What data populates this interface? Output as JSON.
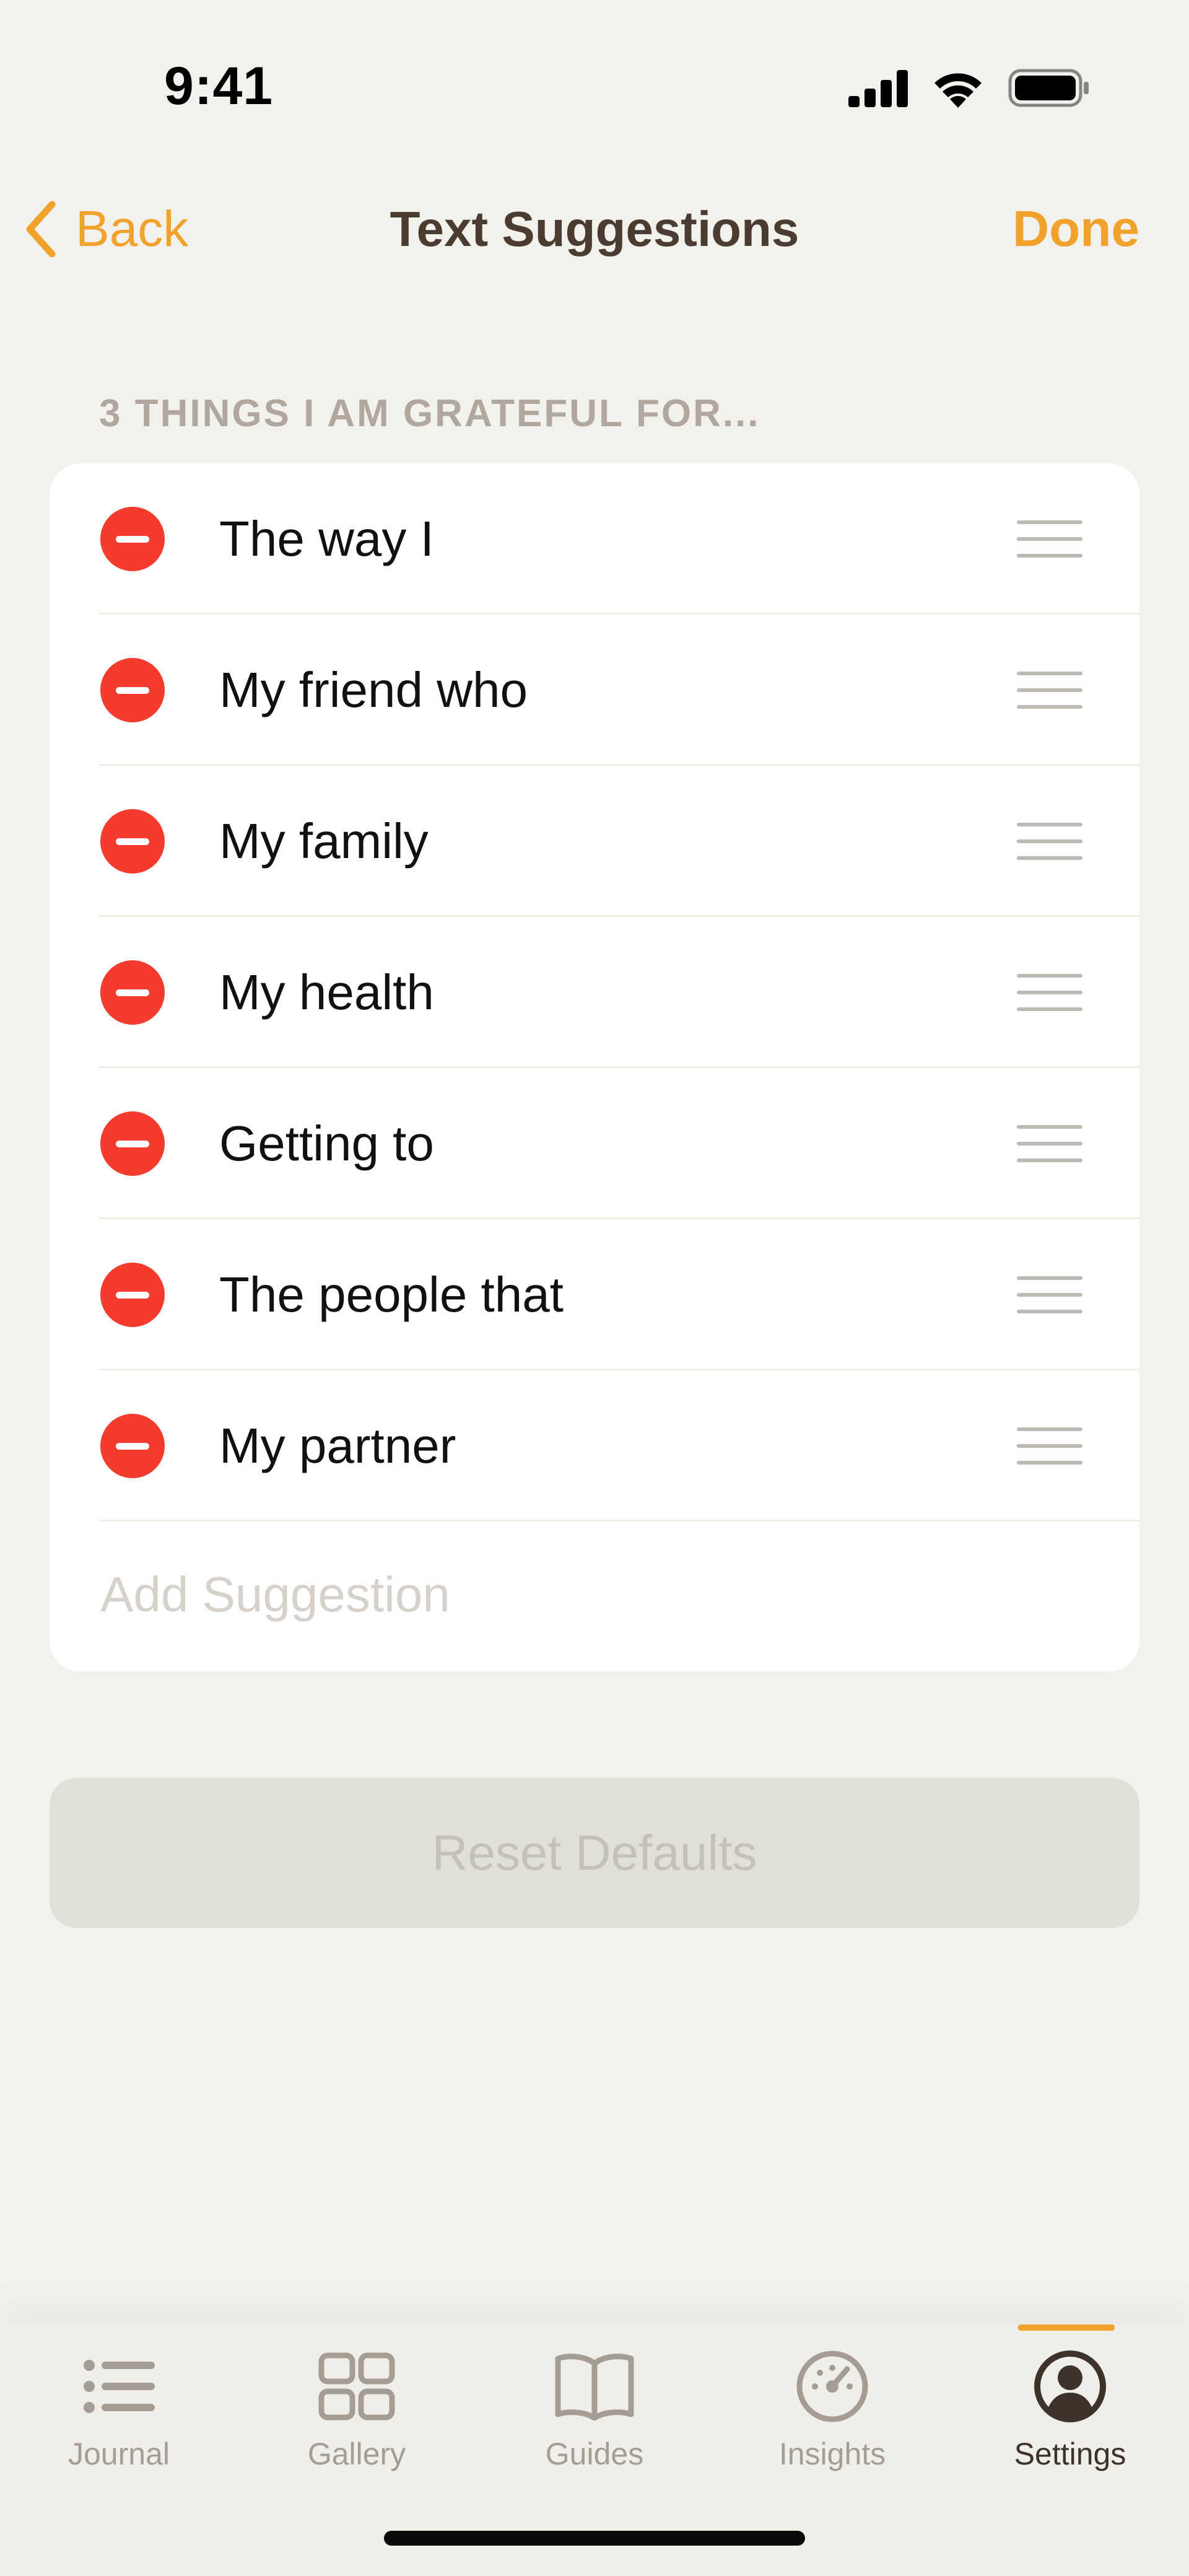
{
  "status_bar": {
    "time": "9:41"
  },
  "nav": {
    "back_label": "Back",
    "title": "Text Suggestions",
    "done_label": "Done"
  },
  "section": {
    "header": "3 THINGS I AM GRATEFUL FOR..."
  },
  "suggestions": [
    "The way I",
    "My friend who",
    "My family",
    "My health",
    "Getting to",
    "The people that",
    "My partner"
  ],
  "add_suggestion": {
    "placeholder": "Add Suggestion",
    "value": ""
  },
  "reset_label": "Reset Defaults",
  "tabs": [
    {
      "label": "Journal",
      "icon": "list-icon",
      "active": false
    },
    {
      "label": "Gallery",
      "icon": "grid-icon",
      "active": false
    },
    {
      "label": "Guides",
      "icon": "book-icon",
      "active": false
    },
    {
      "label": "Insights",
      "icon": "gauge-icon",
      "active": false
    },
    {
      "label": "Settings",
      "icon": "person-circle-icon",
      "active": true
    }
  ],
  "colors": {
    "accent": "#F1A22C",
    "delete": "#F53B2E",
    "title": "#4A3C30",
    "background": "#F2F1EC"
  }
}
